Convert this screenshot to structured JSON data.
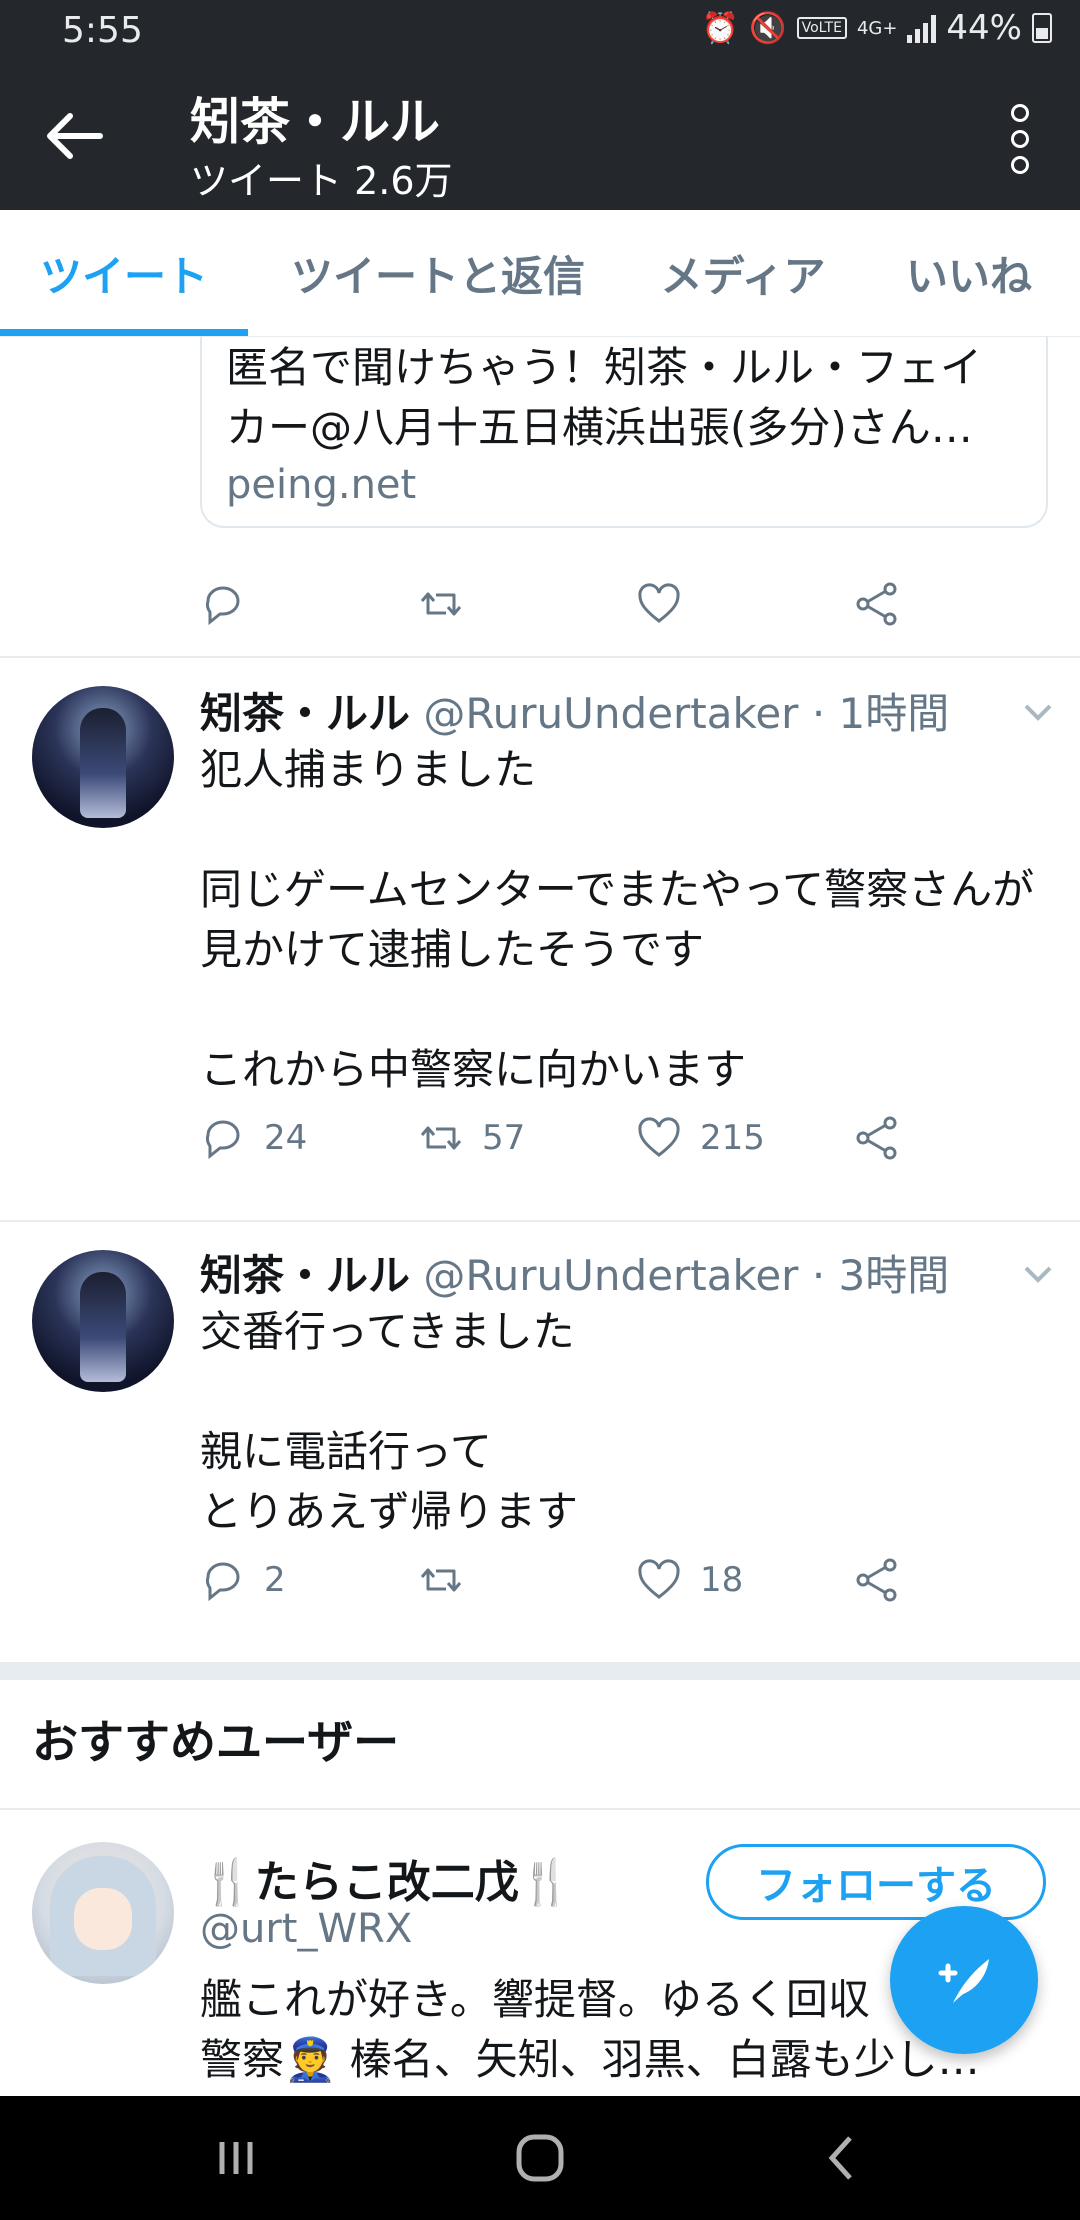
{
  "status_bar": {
    "time": "5:55",
    "network": "4G+",
    "battery": "44%",
    "volte": "VoLTE"
  },
  "header": {
    "title": "矧茶・ルル",
    "subtitle": "ツイート 2.6万"
  },
  "tabs": [
    {
      "label": "ツイート",
      "active": true
    },
    {
      "label": "ツイートと返信",
      "active": false
    },
    {
      "label": "メディア",
      "active": false
    },
    {
      "label": "いいね",
      "active": false
    }
  ],
  "link_card": {
    "text": "匿名で聞けちゃう！矧茶・ルル・フェイカー@八月十五日横浜出張(多分)さん…",
    "domain": "peing.net"
  },
  "tweets": [
    {
      "name": "矧茶・ルル",
      "handle": "@RuruUndertaker",
      "time": "· 1時間",
      "body": "犯人捕まりました\n\n同じゲームセンターでまたやって警察さんが見かけて逮捕したそうです\n\nこれから中警察に向かいます",
      "replies": "24",
      "retweets": "57",
      "likes": "215"
    },
    {
      "name": "矧茶・ルル",
      "handle": "@RuruUndertaker",
      "time": "· 3時間",
      "body": "交番行ってきました\n\n親に電話行って\nとりあえず帰ります",
      "replies": "2",
      "retweets": "",
      "likes": "18"
    }
  ],
  "suggestions": {
    "title": "おすすめユーザー",
    "user": {
      "name": "たらこ改二戊",
      "handle": "@urt_WRX",
      "bio": "艦これが好き。響提督。ゆるく回収\n警察👮 榛名、矢矧、羽黒、白露も少し…",
      "follow_label": "フォローする"
    }
  },
  "colors": {
    "accent": "#1da1f2",
    "header_bg": "#24282c",
    "muted": "#657786"
  }
}
